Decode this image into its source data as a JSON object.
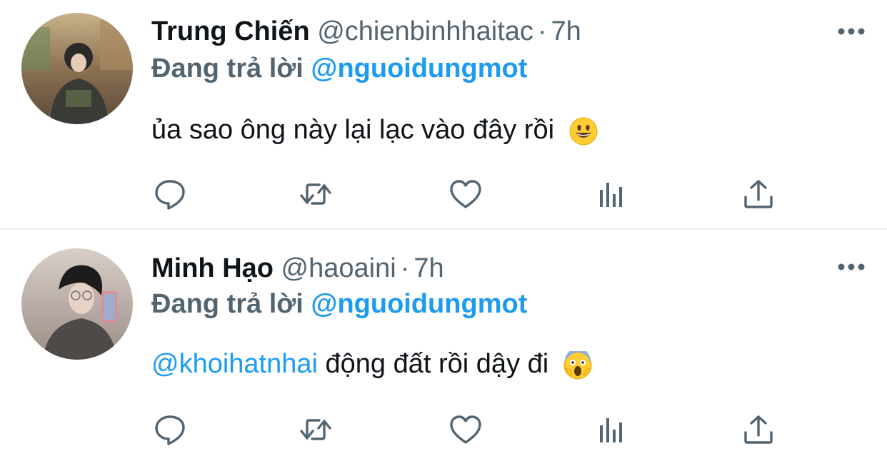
{
  "tweets": [
    {
      "author_name": "Trung Chiến",
      "handle": "@chienbinhhaitac",
      "separator": "·",
      "time": "7h",
      "reply_prefix": "Đang trả lời",
      "reply_to": "@nguoidungmot",
      "mention": "",
      "text": "ủa sao ông này lại lạc vào đây rồi",
      "emoji": "grinning-face-emoji"
    },
    {
      "author_name": "Minh Hạo",
      "handle": "@haoaini",
      "separator": "·",
      "time": "7h",
      "reply_prefix": "Đang trả lời",
      "reply_to": "@nguoidungmot",
      "mention": "@khoihatnhai",
      "text": "động đất rồi dậy đi",
      "emoji": "screaming-face-emoji"
    }
  ],
  "icons": {
    "more": "more-horizontal-icon",
    "reply": "reply-bubble-icon",
    "retweet": "retweet-icon",
    "like": "heart-icon",
    "analytics": "bar-chart-icon",
    "share": "share-upload-icon"
  },
  "colors": {
    "mention": "#1d9bf0",
    "secondary_text": "#536471",
    "primary_text": "#0f1419",
    "divider": "#e6ecf0"
  }
}
